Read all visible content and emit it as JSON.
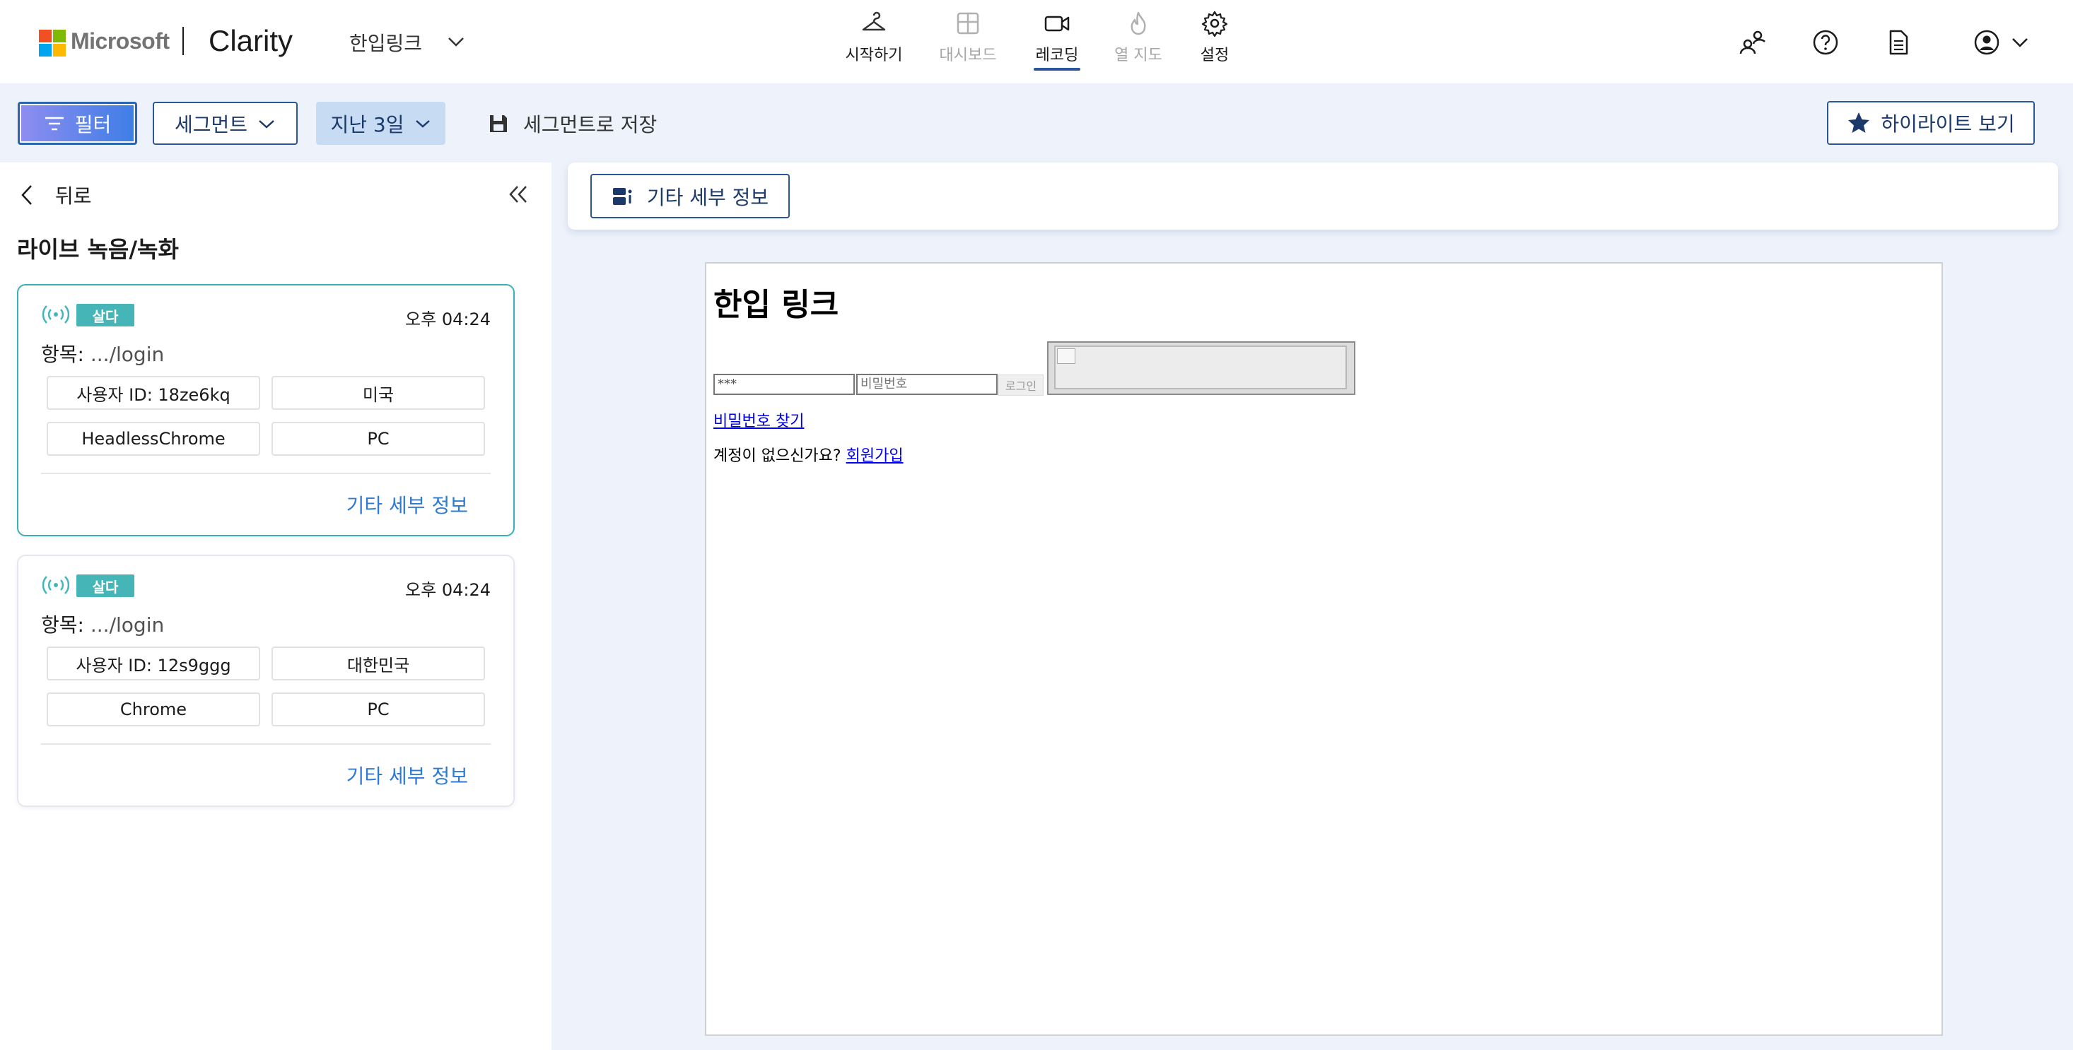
{
  "header": {
    "brand": "Microsoft",
    "product": "Clarity",
    "project_name": "한입링크",
    "nav": [
      {
        "label": "시작하기",
        "icon": "hanger-icon",
        "state": "normal"
      },
      {
        "label": "대시보드",
        "icon": "dashboard-icon",
        "state": "disabled"
      },
      {
        "label": "레코딩",
        "icon": "video-icon",
        "state": "active"
      },
      {
        "label": "열 지도",
        "icon": "flame-icon",
        "state": "disabled"
      },
      {
        "label": "설정",
        "icon": "gear-icon",
        "state": "normal"
      }
    ],
    "right_icons": [
      "users-icon",
      "help-icon",
      "document-icon",
      "account-icon"
    ]
  },
  "toolbar": {
    "filter_label": "필터",
    "segment_label": "세그먼트",
    "date_label": "지난 3일",
    "save_segment_label": "세그먼트로 저장",
    "highlights_label": "하이라이트 보기"
  },
  "left_panel": {
    "back_label": "뒤로",
    "title": "라이브 녹음/녹화",
    "sessions": [
      {
        "badge": "살다",
        "time": "오후 04:24",
        "entry_label": "항목:",
        "entry_value": ".../login",
        "user_id": "사용자 ID: 18ze6kq",
        "country": "미국",
        "browser": "HeadlessChrome",
        "device": "PC",
        "more_label": "기타 세부 정보",
        "selected": true
      },
      {
        "badge": "살다",
        "time": "오후 04:24",
        "entry_label": "항목:",
        "entry_value": ".../login",
        "user_id": "사용자 ID: 12s9ggg",
        "country": "대한민국",
        "browser": "Chrome",
        "device": "PC",
        "more_label": "기타 세부 정보",
        "selected": false
      }
    ]
  },
  "main": {
    "details_button_label": "기타 세부 정보",
    "replay": {
      "page_title": "한입 링크",
      "id_value": "***",
      "password_placeholder": "비밀번호",
      "login_button": "로그인",
      "find_password_link": "비밀번호 찾기",
      "no_account_text": "계정이 없으신가요?",
      "signup_link": "회원가입"
    }
  },
  "colors": {
    "accent": "#2b579a",
    "live_badge": "#45b5b8",
    "link": "#2f7bd3",
    "background": "#eef3fb"
  }
}
